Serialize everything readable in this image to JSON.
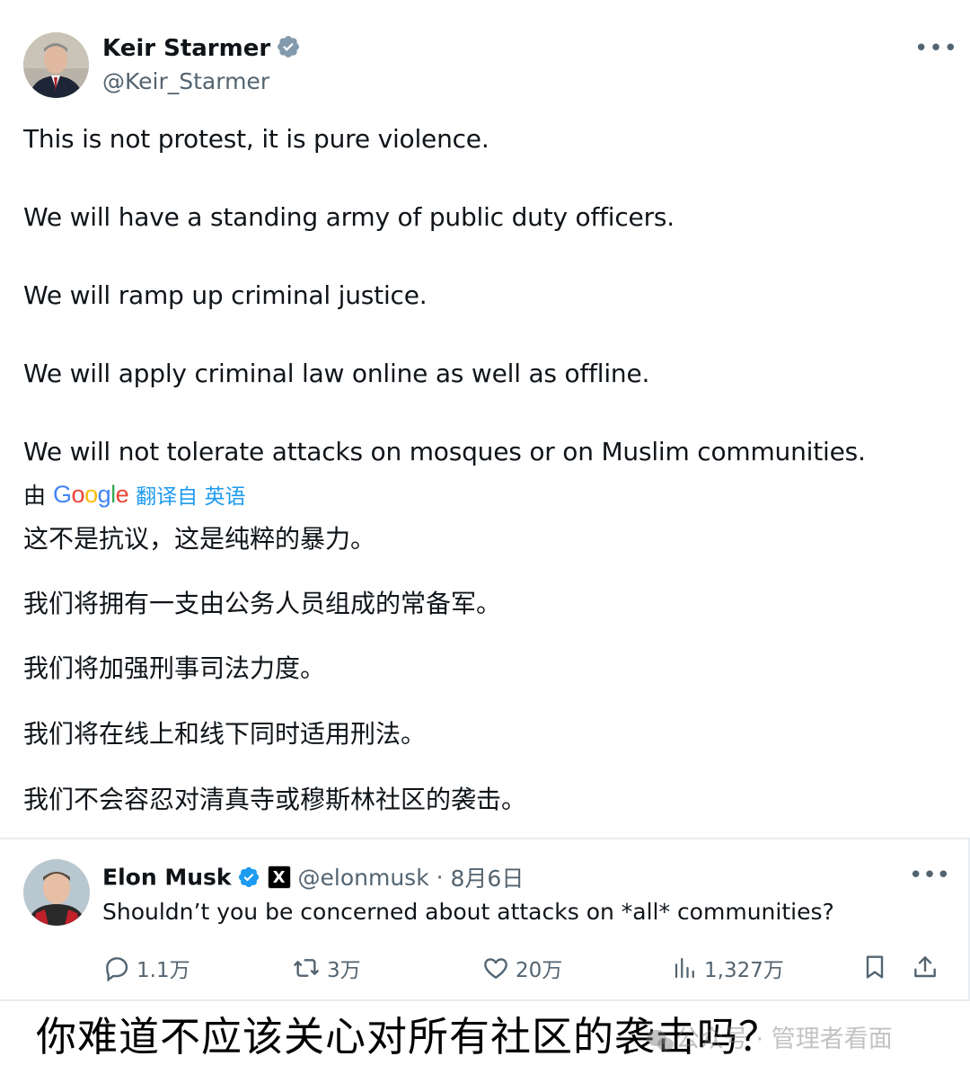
{
  "tweet": {
    "author_name": "Keir Starmer",
    "author_handle": "@Keir_Starmer",
    "more": "•••",
    "lines_en": [
      "This is not protest, it is pure violence.",
      "We will have a standing army of public duty officers.",
      "We will ramp up criminal justice.",
      "We will apply criminal law online as well as offline.",
      "We will not tolerate attacks on mosques or on Muslim communities."
    ],
    "translate_by": "由",
    "translate_brand": "Google",
    "translate_source": "翻译自 英语",
    "lines_zh": [
      "这不是抗议，这是纯粹的暴力。",
      "我们将拥有一支由公务人员组成的常备军。",
      "我们将加强刑事司法力度。",
      "我们将在线上和线下同时适用刑法。",
      "我们不会容忍对清真寺或穆斯林社区的袭击。"
    ]
  },
  "reply": {
    "author_name": "Elon Musk",
    "x_badge": "X",
    "author_handle": "@elonmusk",
    "dot": " · ",
    "date": "8月6日",
    "more": "•••",
    "text": "Shouldn’t you be concerned about attacks on *all* communities?",
    "actions": {
      "replies": "1.1万",
      "reposts": "3万",
      "likes": "20万",
      "views": "1,327万"
    }
  },
  "caption": "你难道不应该关心对所有社区的袭击吗？",
  "watermark": "公众号 · 管理者看面",
  "colors": {
    "accent_blue": "#1d9bf0",
    "text": "#0f1419",
    "secondary": "#536471"
  }
}
